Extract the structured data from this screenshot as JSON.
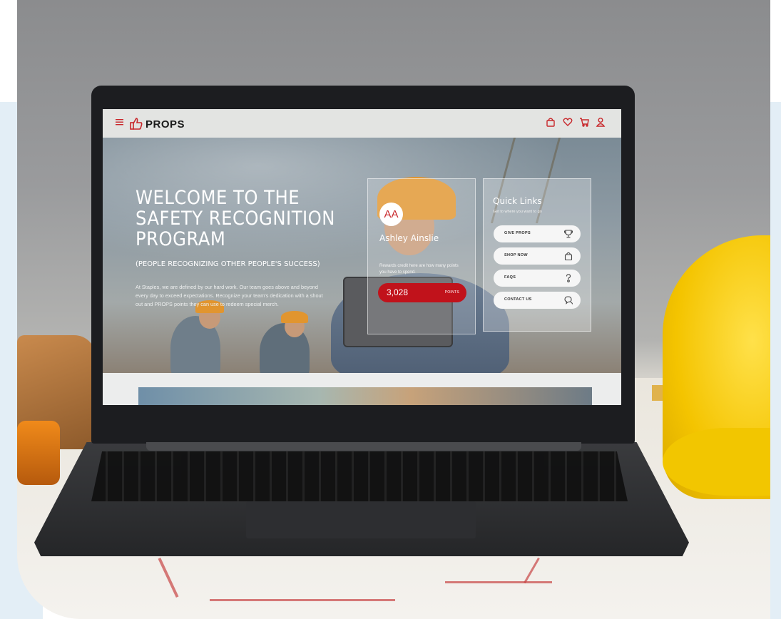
{
  "site": {
    "brand": "PROPS",
    "icons": [
      "menu-icon",
      "thumbs-up-icon",
      "bag-icon",
      "heart-icon",
      "cart-icon",
      "user-icon"
    ]
  },
  "hero": {
    "title": "WELCOME TO THE\nSAFETY RECOGNITION\nPROGRAM",
    "subtitle": "(PEOPLE RECOGNIZING OTHER PEOPLE'S SUCCESS)",
    "body": "At Staples, we are defined by our hard work. Our team goes above and beyond every day to exceed expectations. Recognize your team's dedication with a shout out and PROPS points they can use to redeem special merch."
  },
  "user_card": {
    "initials": "AA",
    "name": "Ashley Ainslie",
    "description": "Rewards credit here are how many points you have to spend.",
    "points": "3,028",
    "points_label": "POINTS"
  },
  "quick_links": {
    "title": "Quick Links",
    "subtitle": "Get to where you want to go",
    "items": [
      {
        "label": "GIVE PROPS",
        "icon": "trophy-icon"
      },
      {
        "label": "SHOP NOW",
        "icon": "bag-icon"
      },
      {
        "label": "FAQS",
        "icon": "question-icon"
      },
      {
        "label": "CONTACT US",
        "icon": "chat-icon"
      }
    ]
  },
  "colors": {
    "accent": "#c8262a",
    "points_pill": "#c1121b",
    "header_bg": "#e3e4e2",
    "hardhat": "#f4c400"
  }
}
